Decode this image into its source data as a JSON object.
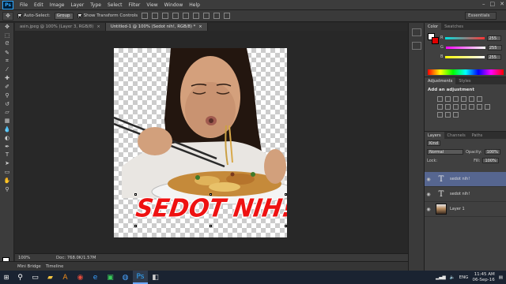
{
  "app": {
    "logo": "Ps",
    "menu": [
      "File",
      "Edit",
      "Image",
      "Layer",
      "Type",
      "Select",
      "Filter",
      "View",
      "Window",
      "Help"
    ],
    "window_controls": [
      "–",
      "□",
      "✕"
    ]
  },
  "options_bar": {
    "auto_select_label": "Auto-Select:",
    "auto_select_value": "Group",
    "show_transform_label": "Show Transform Controls",
    "workspace": "Essentials"
  },
  "doc_tabs": [
    {
      "label": "asin.jpeg @ 100% (Layer 3, RGB/8) ",
      "close": "×"
    },
    {
      "label": "Untitled-1 @ 100% (Sedot nih!, RGB/8) *",
      "close": "×"
    }
  ],
  "canvas": {
    "caption": "SEDOT NIH!"
  },
  "status_bar": {
    "zoom": "100%",
    "doc_size": "Doc: 768.0K/1.57M"
  },
  "bottom_bar": {
    "tabs": [
      "Mini Bridge",
      "Timeline"
    ]
  },
  "color_panel": {
    "tabs": [
      "Color",
      "Swatches"
    ],
    "sliders": [
      {
        "label": "R",
        "value": "255",
        "gradient": "linear-gradient(90deg,#00e0e0,#ff3333)"
      },
      {
        "label": "G",
        "value": "255",
        "gradient": "linear-gradient(90deg,#ff00ff,#ffffff)"
      },
      {
        "label": "B",
        "value": "255",
        "gradient": "linear-gradient(90deg,#ffff00,#ffffff)"
      }
    ]
  },
  "adjustments_panel": {
    "tabs": [
      "Adjustments",
      "Styles"
    ],
    "title": "Add an adjustment"
  },
  "layers_panel": {
    "tabs": [
      "Layers",
      "Channels",
      "Paths"
    ],
    "filter": "Kind",
    "blend_mode": "Normal",
    "opacity_label": "Opacity:",
    "opacity_value": "100%",
    "lock_label": "Lock:",
    "fill_label": "Fill:",
    "fill_value": "100%",
    "layers": [
      {
        "name": "sedot nih!",
        "type": "text",
        "selected": true
      },
      {
        "name": "sedot nih!",
        "type": "text",
        "selected": false
      },
      {
        "name": "Layer 1",
        "type": "image",
        "selected": false
      }
    ],
    "footer_icons": [
      "link-icon",
      "fx-icon",
      "mask-icon",
      "adjustment-icon",
      "folder-icon",
      "new-layer-icon",
      "trash-icon"
    ]
  },
  "taskbar": {
    "time": "11:45 AM",
    "date": "06-Sep-16",
    "lang": "ENG",
    "icons": [
      "search-icon",
      "task-view-icon",
      "chrome-icon",
      "edge-icon",
      "store-icon",
      "photoshop-icon",
      "app-icon"
    ]
  },
  "colors": {
    "accent": "#31a8ff",
    "caption_red": "#ee1111",
    "selected_layer": "#566690"
  }
}
